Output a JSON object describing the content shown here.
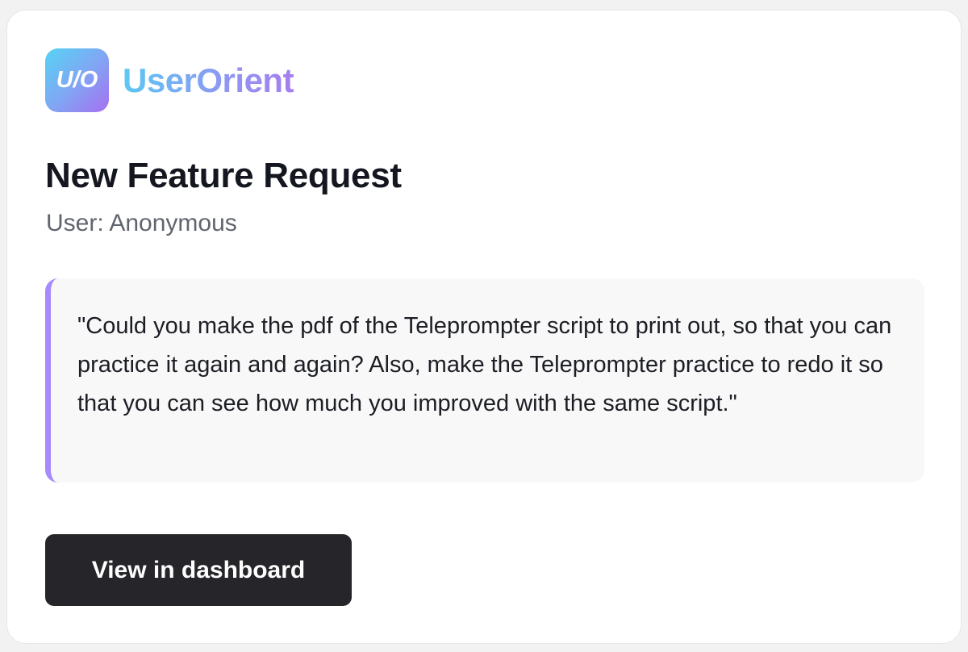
{
  "brand": {
    "logo_mark": "U/O",
    "name": "UserOrient",
    "colors": {
      "gradient_start": "#56d3f5",
      "gradient_end": "#a66ff0"
    }
  },
  "request": {
    "title": "New Feature Request",
    "user_line": "User: Anonymous",
    "quote": "\"Could you make the pdf of the Teleprompter script to print out, so that you can practice it again and again? Also, make the Teleprompter practice to redo it so that you can see how much you improved with the same script.\"",
    "accent_color": "#a78bfa"
  },
  "actions": {
    "view_dashboard_label": "View in dashboard",
    "button_color": "#26262a"
  }
}
